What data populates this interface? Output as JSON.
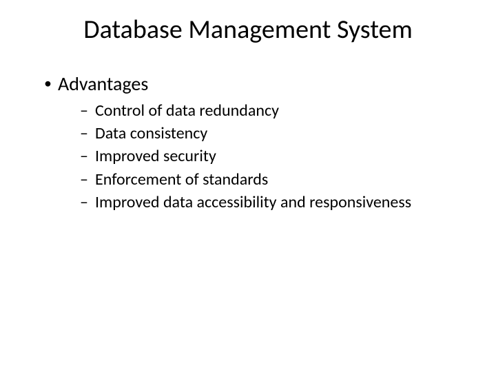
{
  "title": "Database Management System",
  "level1": "Advantages",
  "level2": {
    "item0": "Control of data redundancy",
    "item1": "Data consistency",
    "item2": "Improved security",
    "item3": "Enforcement of standards",
    "item4": "Improved data accessibility and responsiveness"
  }
}
